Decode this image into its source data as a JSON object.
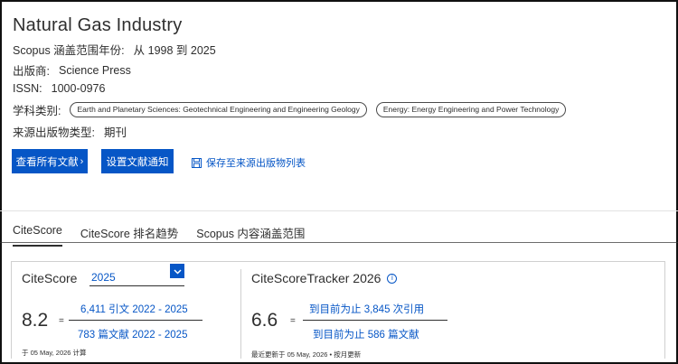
{
  "header": {
    "title": "Natural Gas Industry",
    "coverage_label": "Scopus 涵盖范围年份:",
    "coverage_value": "从 1998 到 2025",
    "publisher_label": "出版商:",
    "publisher_value": "Science Press",
    "issn_label": "ISSN:",
    "issn_value": "1000-0976",
    "subject_label": "学科类别:",
    "subjects": [
      "Earth and Planetary Sciences: Geotechnical Engineering and Engineering Geology",
      "Energy: Energy Engineering and Power Technology"
    ],
    "source_type_label": "来源出版物类型:",
    "source_type_value": "期刊"
  },
  "actions": {
    "view_all_label": "查看所有文献",
    "set_alert_label": "设置文献通知",
    "save_label": "保存至来源出版物列表"
  },
  "tabs": [
    {
      "label": "CiteScore",
      "active": true
    },
    {
      "label": "CiteScore 排名趋势",
      "active": false
    },
    {
      "label": "Scopus 内容涵盖范围",
      "active": false
    }
  ],
  "citescore": {
    "title": "CiteScore",
    "year": "2025",
    "value": "8.2",
    "equals": "=",
    "numerator": "6,411 引文 2022 - 2025",
    "denominator": "783 篇文献 2022 - 2025",
    "note": "于 05 May, 2026 计算"
  },
  "tracker": {
    "title": "CiteScoreTracker 2026",
    "info_icon": "i",
    "value": "6.6",
    "equals": "=",
    "numerator": "到目前为止 3,845 次引用",
    "denominator": "到目前为止 586 篇文献",
    "note": "最近更新于 05 May, 2026 • 按月更新"
  },
  "colors": {
    "accent": "#0656c6",
    "text": "#2e2e2e"
  }
}
